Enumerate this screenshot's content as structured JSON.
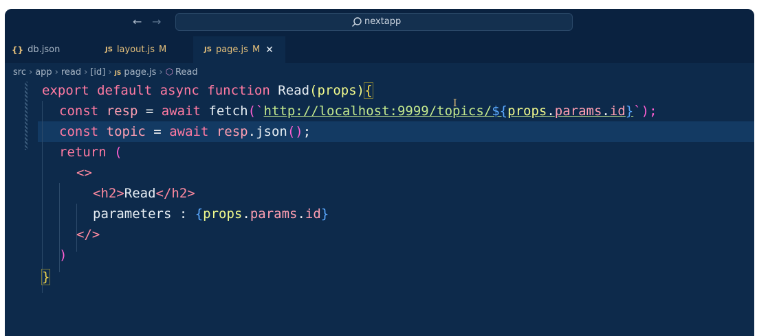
{
  "titlebar": {
    "back_arrow": "←",
    "forward_arrow": "→",
    "search_text": "nextapp"
  },
  "tabs": [
    {
      "icon": "{}",
      "label": "db.json",
      "modified": ""
    },
    {
      "icon": "JS",
      "label": "layout.js",
      "modified": "M"
    },
    {
      "icon": "JS",
      "label": "page.js",
      "modified": "M",
      "close": "✕"
    }
  ],
  "breadcrumb": {
    "parts": [
      "src",
      "app",
      "read",
      "[id]"
    ],
    "file_icon": "JS",
    "file": "page.js",
    "symbol": "Read"
  },
  "code": {
    "l1": {
      "export": "export",
      "default": "default",
      "async": "async",
      "function": "function",
      "name": "Read",
      "params": "(props)",
      "brace": "{"
    },
    "l2": {
      "const": "const",
      "name": "resp",
      "eq": " = ",
      "await": "await",
      "fetch": "fetch",
      "open": "(`",
      "url": "http://localhost:9999/topics/",
      "interp_open": "${",
      "expr1": "props",
      "dot1": ".",
      "expr2": "params",
      "dot2": ".",
      "expr3": "id",
      "interp_close": "}",
      "close": "`);"
    },
    "l3": {
      "const": "const",
      "name": "topic",
      "eq": " = ",
      "await": "await",
      "obj": "resp",
      "dot": ".",
      "method": "json",
      "call": "()",
      "semi": ";"
    },
    "l4": {
      "return": "return",
      "paren": "("
    },
    "l5": {
      "frag": "<>"
    },
    "l6": {
      "open_tag_l": "<h2>",
      "text": "Read",
      "close_tag": "</h2>"
    },
    "l7": {
      "text": "parameters : ",
      "ob": "{",
      "e1": "props",
      "d1": ".",
      "e2": "params",
      "d2": ".",
      "e3": "id",
      "cb": "}"
    },
    "l8": {
      "frag_close": "</>"
    },
    "l9": {
      "paren_close": ")"
    },
    "l10": {
      "brace_close": "}"
    }
  },
  "colors": {
    "editor_bg": "#0d2a4b",
    "titlebar_bg": "#0a2240",
    "current_line": "#133a63",
    "string": "#c3e88d",
    "keyword": "#ff7aa2"
  }
}
